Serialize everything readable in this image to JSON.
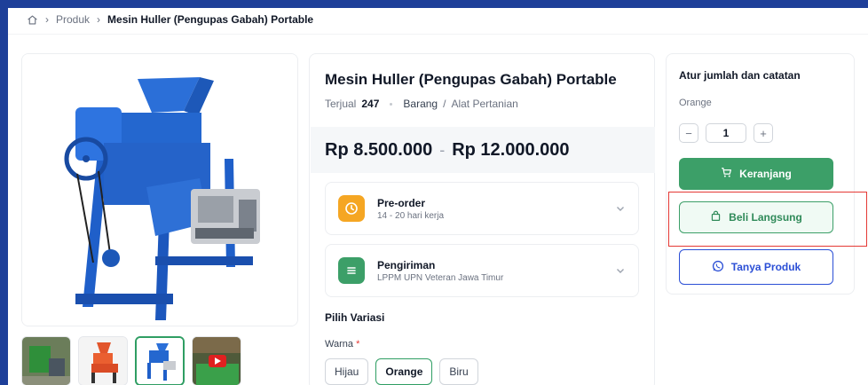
{
  "breadcrumb": {
    "home_icon": "home-icon",
    "produk": "Produk",
    "current": "Mesin Huller (Pengupas Gabah) Portable"
  },
  "product": {
    "title": "Mesin Huller (Pengupas Gabah) Portable",
    "sold_label": "Terjual",
    "sold_count": "247",
    "type": "Barang",
    "category_sep": "/",
    "category": "Alat Pertanian",
    "price_min": "Rp 8.500.000",
    "price_sep": "-",
    "price_max": "Rp 12.000.000"
  },
  "preorder": {
    "title": "Pre-order",
    "subtitle": "14 - 20 hari kerja",
    "icon": "clock-icon",
    "color": "#f5a623"
  },
  "shipping": {
    "title": "Pengiriman",
    "subtitle": "LPPM UPN Veteran Jawa Timur",
    "icon": "list-icon",
    "color": "#3c9f68"
  },
  "variation": {
    "title": "Pilih Variasi",
    "color_label": "Warna",
    "required_mark": "*",
    "options": [
      "Hijau",
      "Orange",
      "Biru"
    ],
    "selected": "Orange"
  },
  "purchase": {
    "title": "Atur jumlah dan catatan",
    "variant": "Orange",
    "minus": "−",
    "quantity": "1",
    "plus": "+",
    "cart_label": "Keranjang",
    "buy_label": "Beli Langsung",
    "ask_label": "Tanya Produk"
  },
  "colors": {
    "accent_green": "#3c9f68",
    "accent_blue": "#2b4fd6",
    "highlight_red": "#e53935"
  }
}
